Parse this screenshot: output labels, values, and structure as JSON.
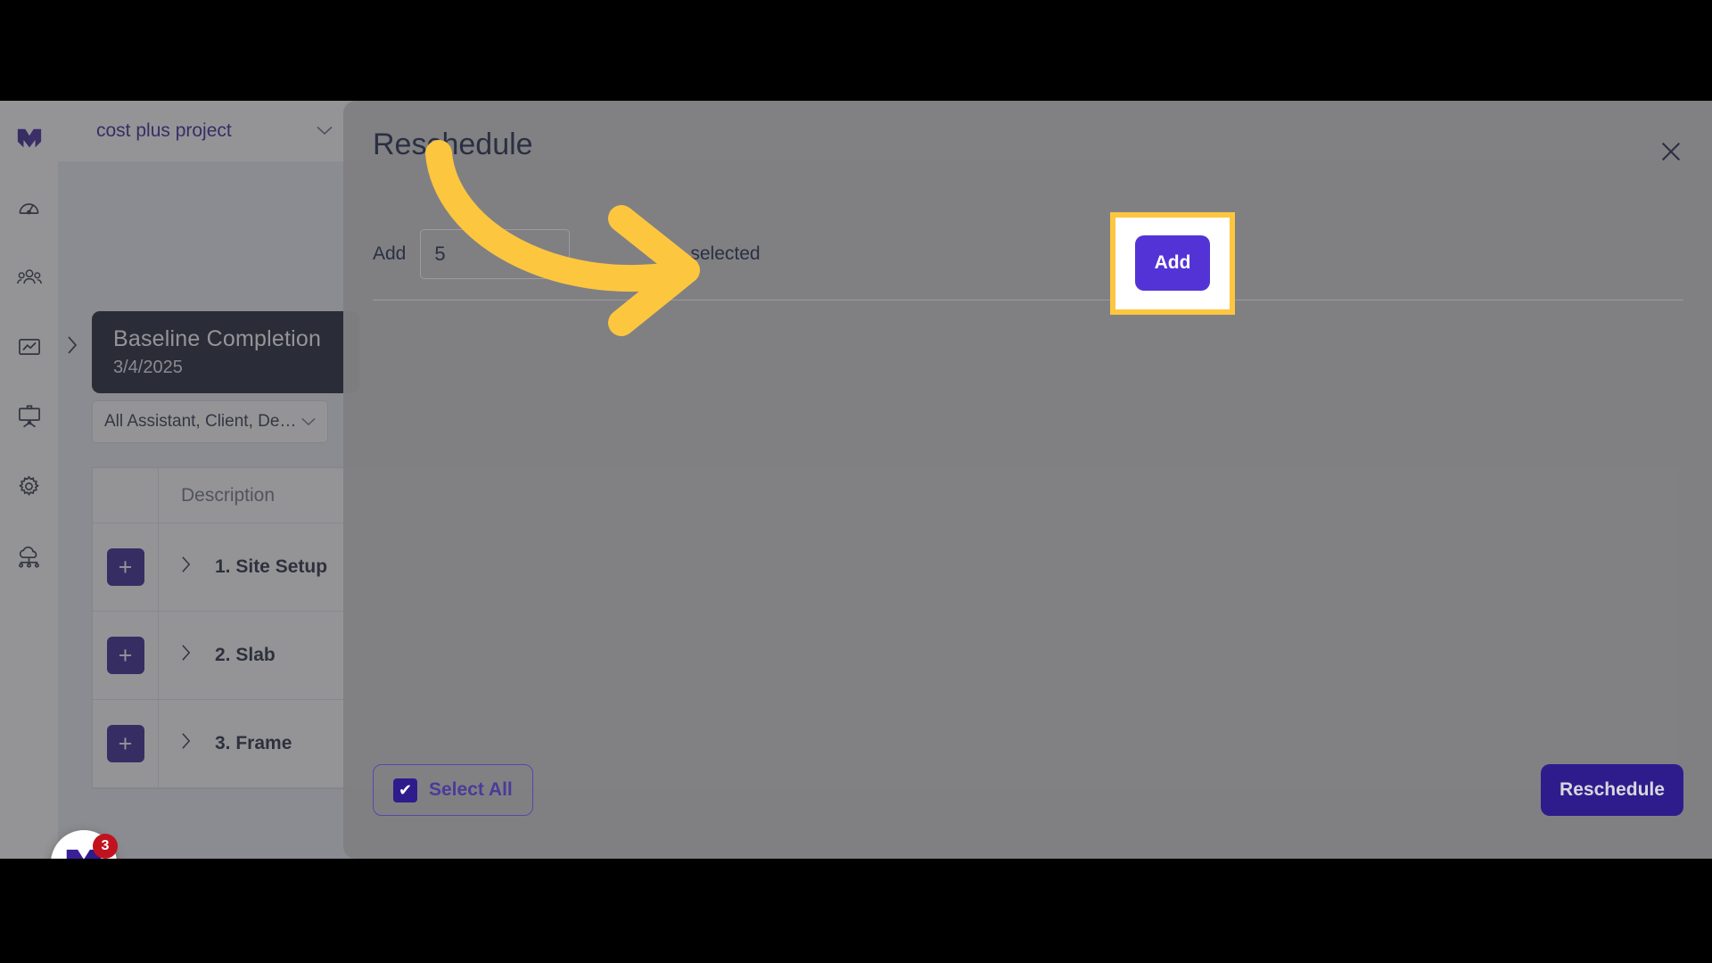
{
  "app": {
    "rail_items": [
      {
        "icon": "brand-logo-icon",
        "label": "Mastt"
      },
      {
        "icon": "dashboard-gauge-icon",
        "label": "Dashboard"
      },
      {
        "icon": "people-group-icon",
        "label": "Team"
      },
      {
        "icon": "chart-trend-icon",
        "label": "Reports"
      },
      {
        "icon": "presentation-board-icon",
        "label": "Programme"
      },
      {
        "icon": "gear-icon",
        "label": "Settings"
      },
      {
        "icon": "cloud-network-icon",
        "label": "Integrations"
      }
    ]
  },
  "topbar": {
    "project_name": "cost plus project",
    "chevron": "⌄"
  },
  "timeline": {
    "collapse_chevron": "›",
    "baseline_card": {
      "title": "Baseline Completion",
      "date": "3/4/2025"
    }
  },
  "table_panel": {
    "filter": {
      "value": "All Assistant, Client, De…",
      "chevron": "⌄"
    },
    "columns": [
      "",
      "Description"
    ],
    "add_glyph": "+",
    "row_chevron": "›",
    "rows": [
      {
        "label": "1. Site Setup"
      },
      {
        "label": "2. Slab"
      },
      {
        "label": "3. Frame"
      }
    ]
  },
  "launcher": {
    "badge_count": "3",
    "logo": "mastt-logo-icon"
  },
  "modal": {
    "title": "Reschedule",
    "close_glyph": "✕",
    "add_row": {
      "prefix_label": "Add",
      "input_value": "5",
      "input_placeholder": "0",
      "suffix_label": "selected",
      "add_button_label": "Add"
    },
    "footer": {
      "select_all_label": "Select All",
      "select_all_checked": true,
      "checkmark_glyph": "✔",
      "reschedule_label": "Reschedule"
    }
  },
  "annotation": {
    "highlight_color": "#fcc63f",
    "arrow_target": "add-button"
  },
  "colors": {
    "brand_purple": "#2f1c8c",
    "accent_violet": "#5433d6",
    "dark_navy": "#151a2e",
    "highlight_yellow": "#fcc63f",
    "badge_red": "#c1121f"
  }
}
